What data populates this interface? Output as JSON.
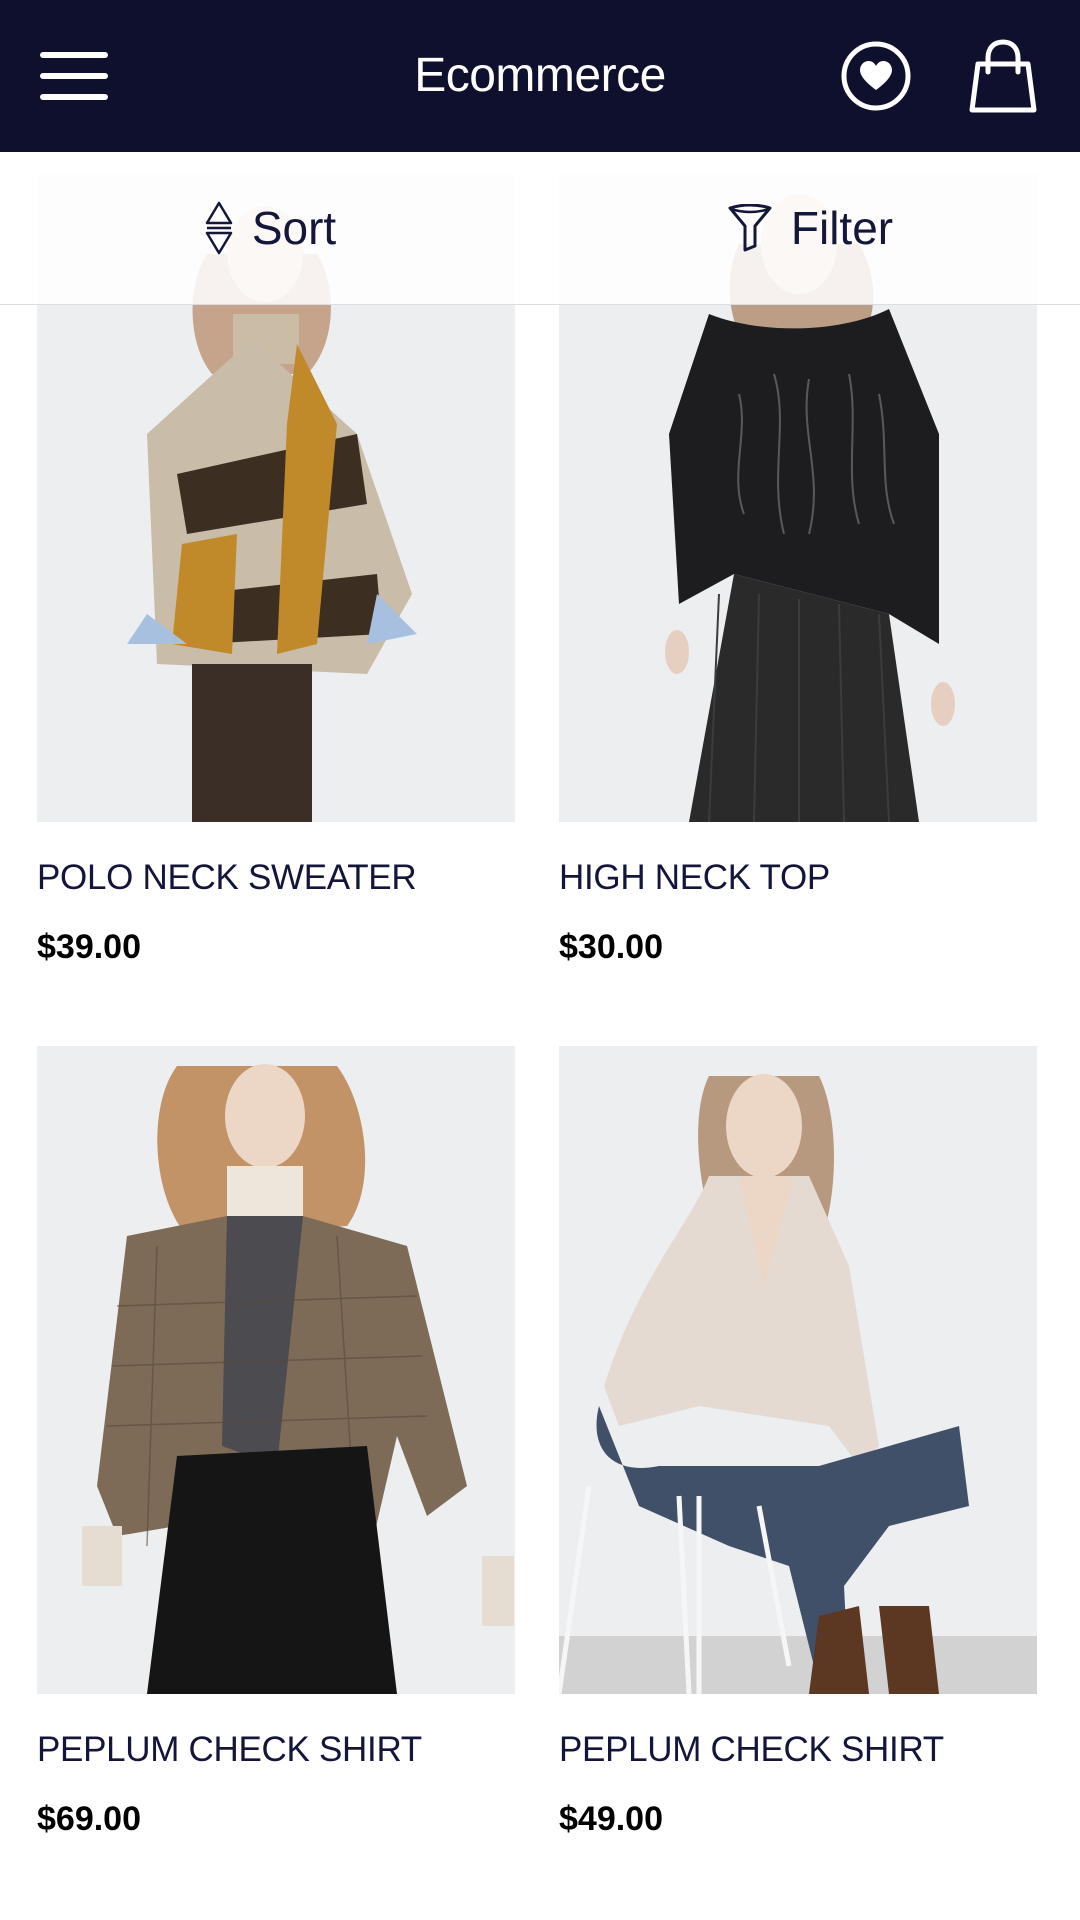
{
  "header": {
    "title": "Ecommerce",
    "icons": [
      "menu-icon",
      "heart-icon",
      "shopping-bag-icon"
    ],
    "background": "#0e102d"
  },
  "toolbar": {
    "sort_label": "Sort",
    "filter_label": "Filter"
  },
  "products": [
    {
      "name": "POLO NECK SWEATER",
      "price": "$39.00"
    },
    {
      "name": "HIGH NECK TOP",
      "price": "$30.00"
    },
    {
      "name": "PEPLUM CHECK SHIRT",
      "price": "$69.00"
    },
    {
      "name": "PEPLUM CHECK SHIRT",
      "price": "$49.00"
    }
  ]
}
